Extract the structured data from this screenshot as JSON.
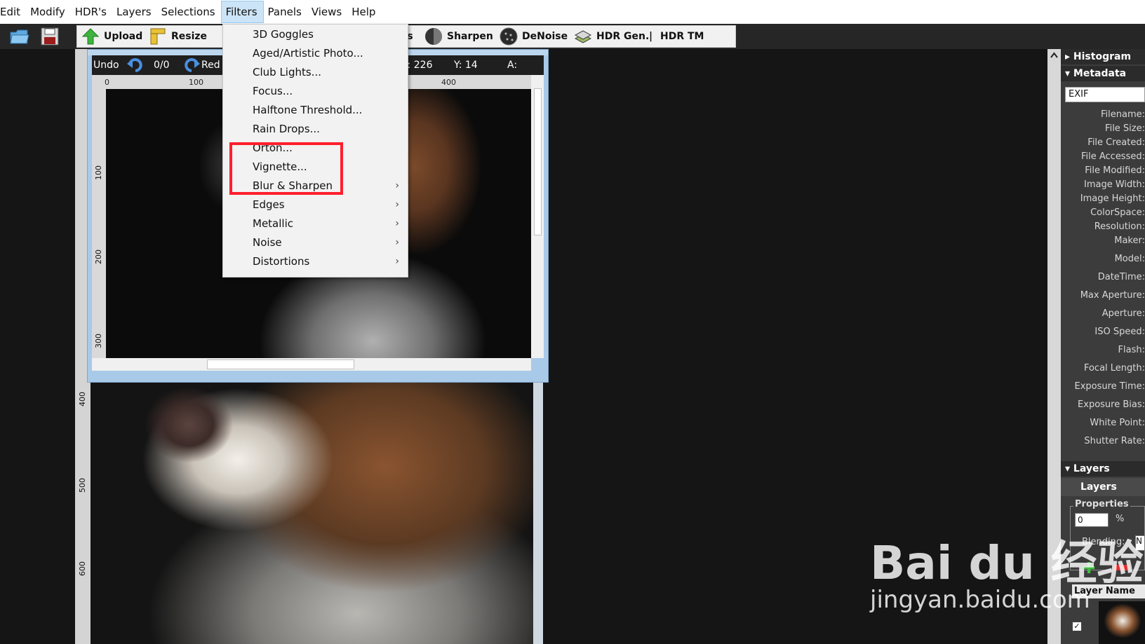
{
  "menubar": [
    "Edit",
    "Modify",
    "HDR's",
    "Layers",
    "Selections",
    "Filters",
    "Panels",
    "Views",
    "Help"
  ],
  "toolbar": {
    "buttons": [
      "Upload",
      "Resize",
      "lors",
      "Sharpen",
      "DeNoise",
      "HDR Gen.",
      "|",
      "HDR TM"
    ]
  },
  "image_window": {
    "undo": "Undo",
    "history": "0/0",
    "redo": "Red",
    "x": "X: 226",
    "y": "Y: 14",
    "a": "A:",
    "ruler_top": [
      "0",
      "100",
      "400"
    ],
    "ruler_left": [
      "100",
      "200",
      "300"
    ]
  },
  "back_ruler": [
    "400",
    "500",
    "600"
  ],
  "filters_menu": {
    "items": [
      {
        "label": "3D Goggles",
        "submenu": false
      },
      {
        "label": "Aged/Artistic Photo...",
        "submenu": false
      },
      {
        "label": "Club Lights...",
        "submenu": false
      },
      {
        "label": "Focus...",
        "submenu": false
      },
      {
        "label": "Halftone Threshold...",
        "submenu": false
      },
      {
        "label": "Rain Drops...",
        "submenu": false
      },
      {
        "label": "Orton...",
        "submenu": false
      },
      {
        "label": "Vignette...",
        "submenu": false
      },
      {
        "label": "Blur & Sharpen",
        "submenu": true
      },
      {
        "label": "Edges",
        "submenu": true
      },
      {
        "label": "Metallic",
        "submenu": true
      },
      {
        "label": "Noise",
        "submenu": true
      },
      {
        "label": "Distortions",
        "submenu": true
      }
    ],
    "highlight_color": "#ff1f2d"
  },
  "panel": {
    "histogram": "Histogram",
    "metadata": "Metadata",
    "exif_select": "EXIF",
    "meta_fields": [
      "Filename:",
      "File Size:",
      "File Created:",
      "File Accessed:",
      "File Modified:",
      "Image Width:",
      "Image Height:",
      "ColorSpace:",
      "Resolution:",
      "Maker:",
      "Model:",
      "DateTime:",
      "Max Aperture:",
      "Aperture:",
      "ISO Speed:",
      "Flash:",
      "Focal Length:",
      "Exposure Time:",
      "Exposure Bias:",
      "White Point:",
      "Shutter Rate:"
    ],
    "layers_head": "Layers",
    "layers_sub": "Layers",
    "properties": "Properties",
    "opacity_value": "0",
    "percent": "%",
    "blending_label": "Blending:",
    "blending_value": "N",
    "layer_name_head": "Layer Name",
    "layer_checked": "✓"
  },
  "watermark": {
    "main": "Bai du 经验",
    "sub": "jingyan.baidu.com"
  }
}
